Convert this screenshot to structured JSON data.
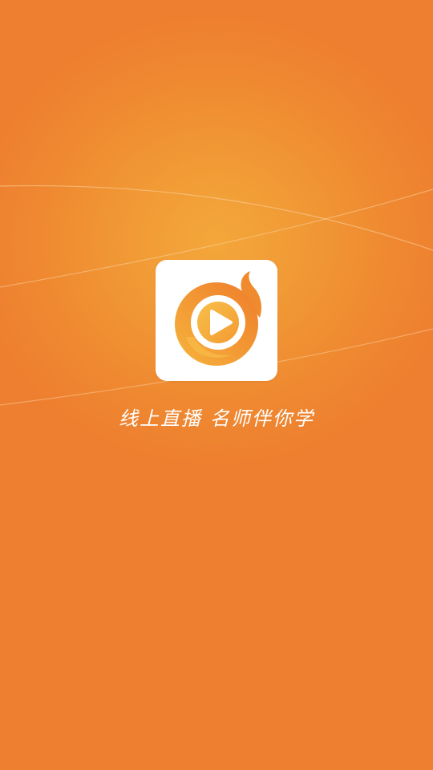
{
  "splash": {
    "slogan_part1": "线上直播",
    "slogan_part2": "名师伴你学",
    "logo_icon": "flame-play-icon"
  },
  "colors": {
    "background": "#ee7f30",
    "background_glow": "#f4a73a",
    "logo_orange": "#f28a2b",
    "logo_gold": "#f6b23a",
    "icon_tile": "#ffffff",
    "text": "#ffffff"
  }
}
